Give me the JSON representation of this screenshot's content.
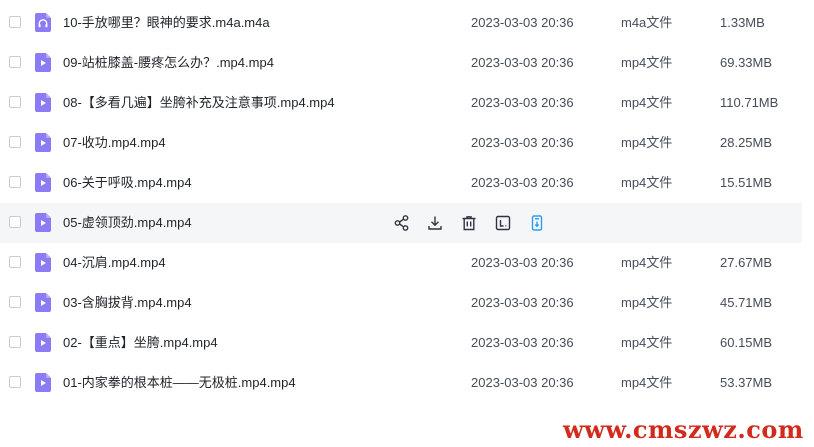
{
  "files": [
    {
      "name": "10-手放哪里？眼神的要求.m4a.m4a",
      "date": "2023-03-03 20:36",
      "type": "m4a文件",
      "size": "1.33MB",
      "icon": "headphones-icon"
    },
    {
      "name": "09-站桩膝盖-腰疼怎么办？.mp4.mp4",
      "date": "2023-03-03 20:36",
      "type": "mp4文件",
      "size": "69.33MB",
      "icon": "video-file-icon"
    },
    {
      "name": "08-【多看几遍】坐胯补充及注意事项.mp4.mp4",
      "date": "2023-03-03 20:36",
      "type": "mp4文件",
      "size": "110.71MB",
      "icon": "video-file-icon"
    },
    {
      "name": "07-收功.mp4.mp4",
      "date": "2023-03-03 20:36",
      "type": "mp4文件",
      "size": "28.25MB",
      "icon": "video-file-icon"
    },
    {
      "name": "06-关于呼吸.mp4.mp4",
      "date": "2023-03-03 20:36",
      "type": "mp4文件",
      "size": "15.51MB",
      "icon": "video-file-icon"
    },
    {
      "name": "05-虚领顶劲.mp4.mp4",
      "date": "",
      "type": "",
      "size": "",
      "icon": "video-file-icon",
      "hover": true
    },
    {
      "name": "04-沉肩.mp4.mp4",
      "date": "2023-03-03 20:36",
      "type": "mp4文件",
      "size": "27.67MB",
      "icon": "video-file-icon"
    },
    {
      "name": "03-含胸拔背.mp4.mp4",
      "date": "2023-03-03 20:36",
      "type": "mp4文件",
      "size": "45.71MB",
      "icon": "video-file-icon"
    },
    {
      "name": "02-【重点】坐胯.mp4.mp4",
      "date": "2023-03-03 20:36",
      "type": "mp4文件",
      "size": "60.15MB",
      "icon": "video-file-icon"
    },
    {
      "name": "01-内家拳的根本桩——无极桩.mp4.mp4",
      "date": "2023-03-03 20:36",
      "type": "mp4文件",
      "size": "53.37MB",
      "icon": "video-file-icon"
    }
  ],
  "hover_actions": [
    "share-icon",
    "download-icon",
    "delete-icon",
    "rename-icon",
    "save-to-phone-icon"
  ],
  "colors": {
    "file_icon": "#8b7cf6",
    "file_icon_fold": "#b4aaf9",
    "hover_row": "#f5f6f8",
    "action_icon": "#2e3440",
    "action_accent": "#2e9bf0",
    "watermark": "#d22a1d"
  },
  "watermark": "www.cmszwz.com"
}
